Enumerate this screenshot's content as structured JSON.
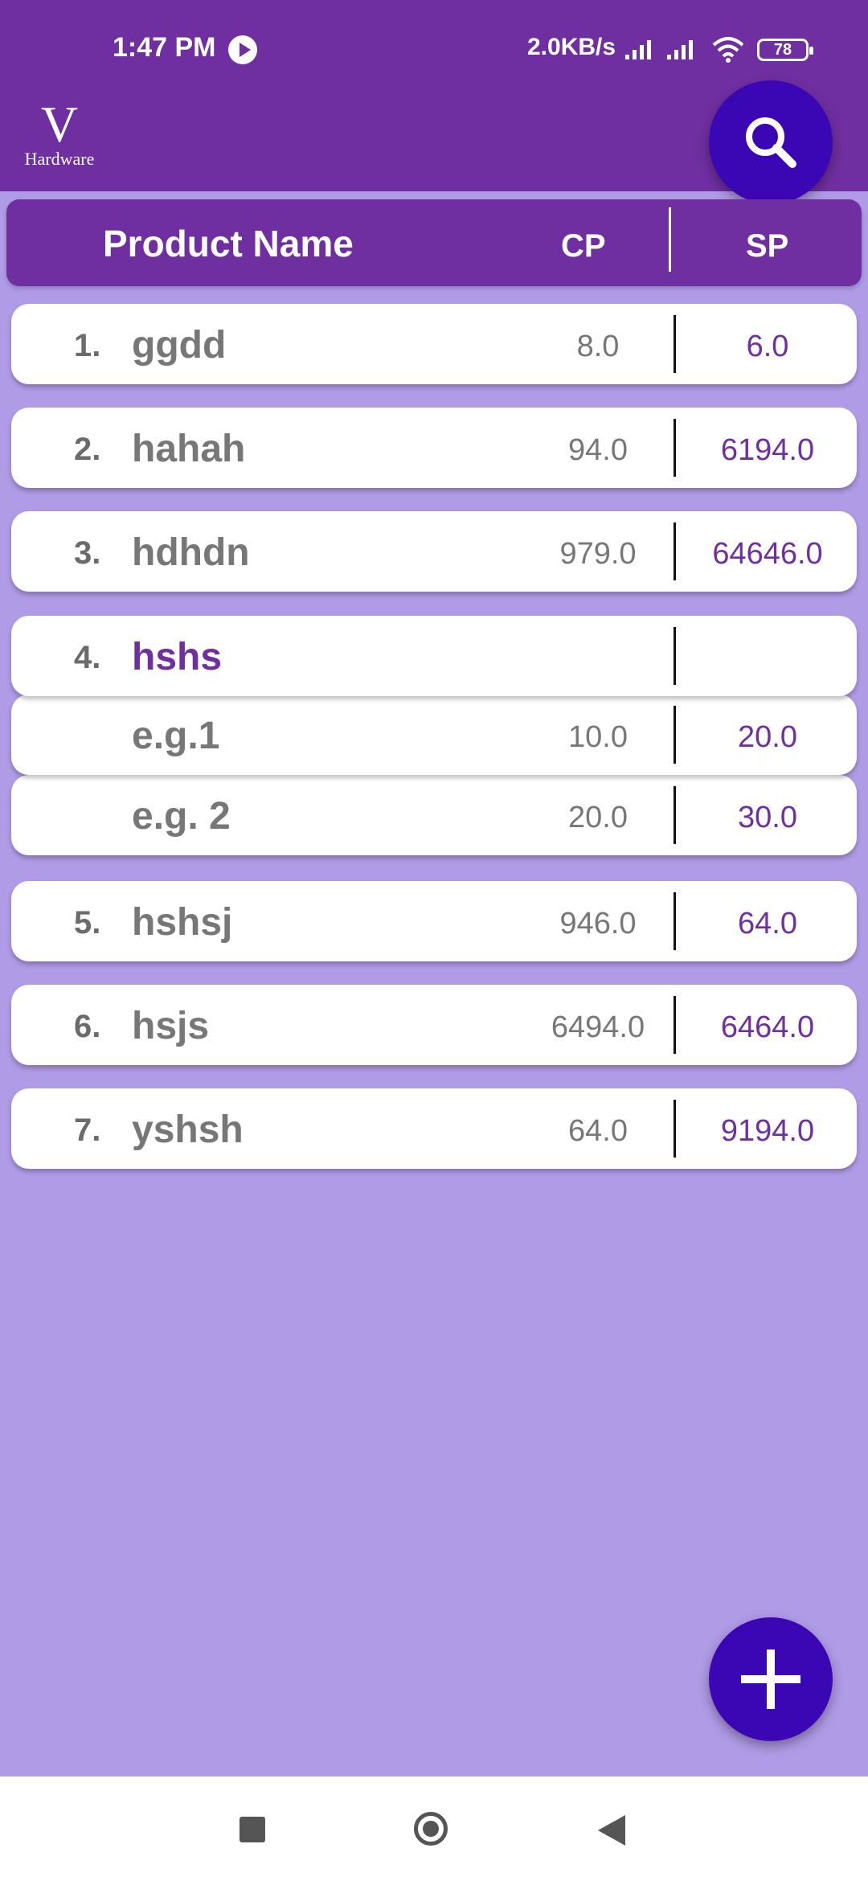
{
  "status": {
    "time": "1:47 PM",
    "network_speed": "2.0KB/s",
    "battery": "78",
    "icons": [
      "play-icon",
      "signal-icon",
      "wifi-icon",
      "battery-icon"
    ]
  },
  "app": {
    "logo_letter": "V",
    "logo_text": "Hardware",
    "search_icon": "search-icon",
    "add_icon": "plus-icon"
  },
  "header": {
    "name": "Product Name",
    "cp": "CP",
    "sp": "SP"
  },
  "products": [
    {
      "num": "1.",
      "name": "ggdd",
      "cp": "8.0",
      "sp": "6.0"
    },
    {
      "num": "2.",
      "name": "hahah",
      "cp": "94.0",
      "sp": "6194.0"
    },
    {
      "num": "3.",
      "name": "hdhdn",
      "cp": "979.0",
      "sp": "64646.0"
    },
    {
      "num": "4.",
      "name": "hshs",
      "cp": "",
      "sp": "",
      "variants": [
        {
          "name": "e.g.1",
          "cp": "10.0",
          "sp": "20.0"
        },
        {
          "name": "e.g. 2",
          "cp": "20.0",
          "sp": "30.0"
        }
      ]
    },
    {
      "num": "5.",
      "name": "hshsj",
      "cp": "946.0",
      "sp": "64.0"
    },
    {
      "num": "6.",
      "name": "hsjs",
      "cp": "6494.0",
      "sp": "6464.0"
    },
    {
      "num": "7.",
      "name": "yshsh",
      "cp": "64.0",
      "sp": "9194.0"
    }
  ],
  "colors": {
    "primary": "#6f2fa0",
    "accent": "#3b06b4",
    "background": "#b09be6"
  }
}
